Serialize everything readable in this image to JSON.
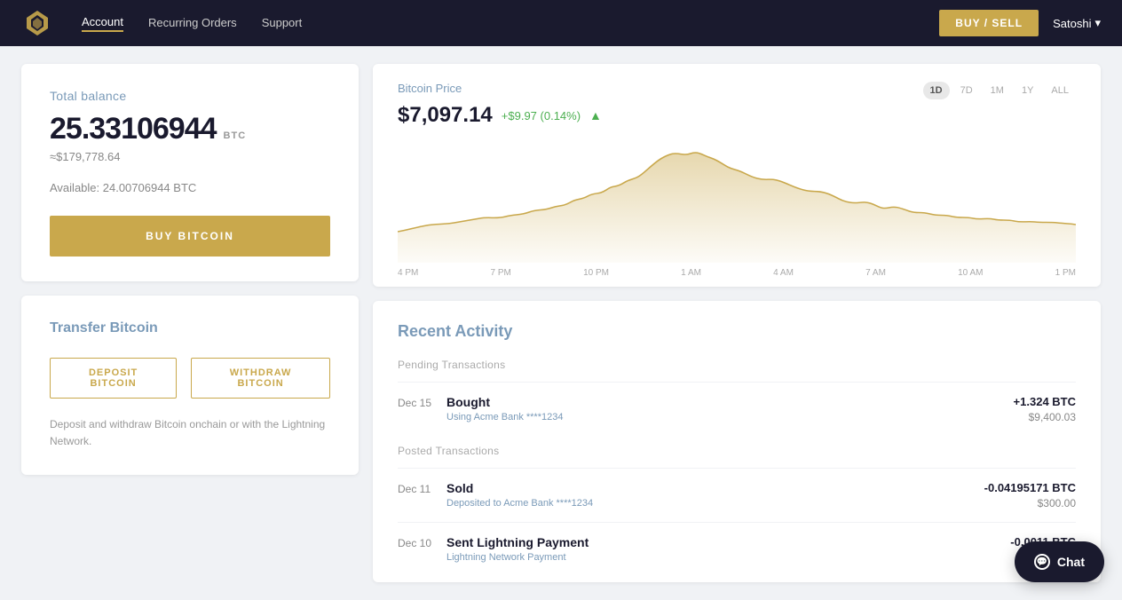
{
  "header": {
    "logo_alt": "River Logo",
    "nav": [
      {
        "label": "Account",
        "active": true
      },
      {
        "label": "Recurring Orders",
        "active": false
      },
      {
        "label": "Support",
        "active": false
      }
    ],
    "buy_sell_label": "BUY / SELL",
    "user_name": "Satoshi"
  },
  "balance_card": {
    "label": "Total balance",
    "btc_amount": "25.33106944",
    "btc_unit": "BTC",
    "usd_approx": "≈$179,778.64",
    "available": "Available: 24.00706944 BTC",
    "buy_button": "BUY BITCOIN"
  },
  "transfer_card": {
    "title": "Transfer Bitcoin",
    "deposit_btn": "DEPOSIT BITCOIN",
    "withdraw_btn": "WITHDRAW BITCOIN",
    "description": "Deposit and withdraw Bitcoin onchain or with the Lightning Network."
  },
  "price_card": {
    "title": "Bitcoin Price",
    "price": "$7,097.14",
    "change": "+$9.97 (0.14%)",
    "time_filters": [
      "1D",
      "7D",
      "1M",
      "1Y",
      "ALL"
    ],
    "active_filter": "1D",
    "chart_labels": [
      "4 PM",
      "7 PM",
      "10 PM",
      "1 AM",
      "4 AM",
      "7 AM",
      "10 AM",
      "1 PM"
    ]
  },
  "activity_card": {
    "title": "Recent Activity",
    "pending_label": "Pending Transactions",
    "posted_label": "Posted Transactions",
    "transactions": [
      {
        "section": "pending",
        "date": "Dec 15",
        "type": "Bought",
        "sub": "Using Acme Bank ****1234",
        "btc": "+1.324 BTC",
        "usd": "$9,400.03",
        "positive": true
      },
      {
        "section": "posted",
        "date": "Dec 11",
        "type": "Sold",
        "sub": "Deposited to Acme Bank ****1234",
        "btc": "-0.04195171 BTC",
        "usd": "$300.00",
        "positive": false
      },
      {
        "section": "posted",
        "date": "Dec 10",
        "type": "Sent Lightning Payment",
        "sub": "Lightning Network Payment",
        "btc": "-0.0011 BTC",
        "usd": "",
        "positive": false
      }
    ]
  },
  "chat": {
    "label": "Chat"
  }
}
